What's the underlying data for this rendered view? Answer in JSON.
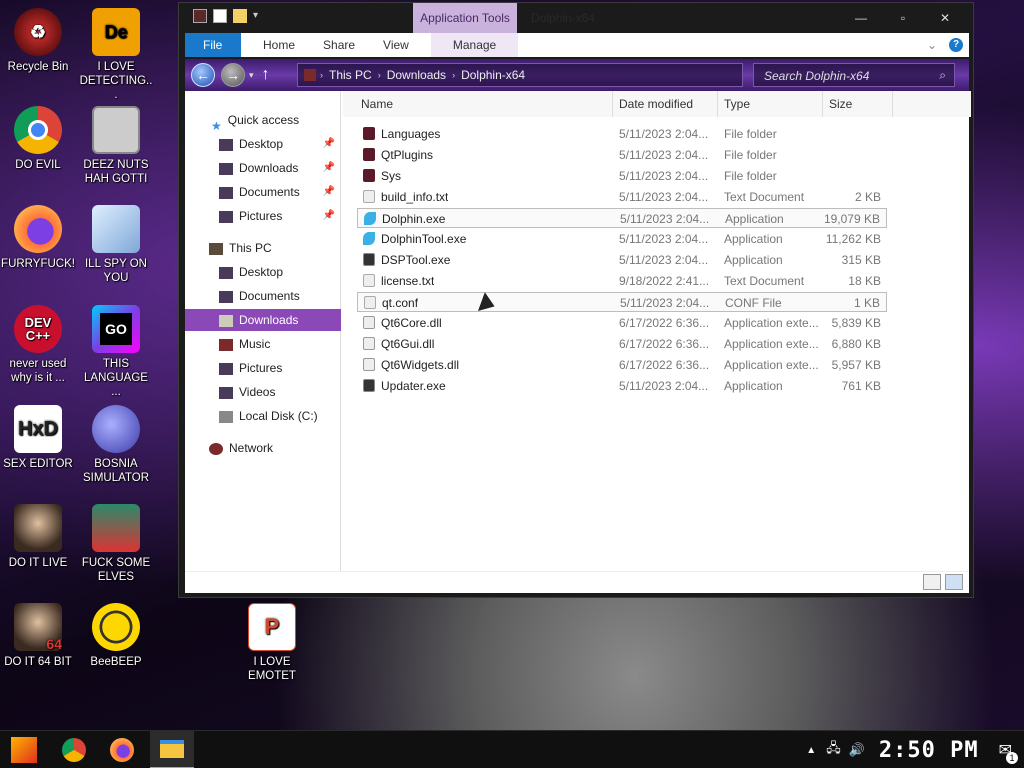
{
  "desktop": {
    "icons": [
      {
        "label": "Recycle Bin"
      },
      {
        "label": "I LOVE DETECTING..."
      },
      {
        "label": "DO EVIL"
      },
      {
        "label": "DEEZ NUTS HAH GOTTI"
      },
      {
        "label": "FURRYFUCK!"
      },
      {
        "label": "ILL SPY ON YOU"
      },
      {
        "label": "never used why is it ..."
      },
      {
        "label": "THIS LANGUAGE ..."
      },
      {
        "label": "SEX EDITOR"
      },
      {
        "label": "BOSNIA SIMULATOR"
      },
      {
        "label": "DO IT LIVE"
      },
      {
        "label": "FUCK SOME ELVES"
      },
      {
        "label": "DO IT 64 BIT"
      },
      {
        "label": "BeeBEEP"
      },
      {
        "label": "I LOVE EMOTET"
      }
    ]
  },
  "window": {
    "contextual_tab": "Application Tools",
    "title": "Dolphin-x64",
    "controls": {
      "minimize": "—",
      "maximize": "▫",
      "close": "✕"
    },
    "ribbon_tabs": [
      "File",
      "Home",
      "Share",
      "View",
      "Manage"
    ],
    "breadcrumb": [
      "This PC",
      "Downloads",
      "Dolphin-x64"
    ],
    "search_placeholder": "Search Dolphin-x64"
  },
  "navpane": {
    "items": [
      {
        "label": "Quick access",
        "icon": "star-icon"
      },
      {
        "label": "Desktop",
        "icon": "desktop-folder-icon",
        "pinned": true
      },
      {
        "label": "Downloads",
        "icon": "downloads-folder-icon",
        "pinned": true
      },
      {
        "label": "Documents",
        "icon": "documents-folder-icon",
        "pinned": true
      },
      {
        "label": "Pictures",
        "icon": "pictures-folder-icon",
        "pinned": true
      },
      {
        "label": "This PC",
        "icon": "computer-icon"
      },
      {
        "label": "Desktop",
        "icon": "desktop-folder-icon"
      },
      {
        "label": "Documents",
        "icon": "documents-folder-icon"
      },
      {
        "label": "Downloads",
        "icon": "downloads-folder-icon",
        "selected": true
      },
      {
        "label": "Music",
        "icon": "music-folder-icon"
      },
      {
        "label": "Pictures",
        "icon": "pictures-folder-icon"
      },
      {
        "label": "Videos",
        "icon": "videos-folder-icon"
      },
      {
        "label": "Local Disk (C:)",
        "icon": "drive-icon"
      },
      {
        "label": "Network",
        "icon": "network-icon"
      }
    ]
  },
  "columns": {
    "name": "Name",
    "date": "Date modified",
    "type": "Type",
    "size": "Size"
  },
  "files": [
    {
      "name": "Languages",
      "date": "5/11/2023 2:04...",
      "type": "File folder",
      "size": "",
      "icon": "folder-icon"
    },
    {
      "name": "QtPlugins",
      "date": "5/11/2023 2:04...",
      "type": "File folder",
      "size": "",
      "icon": "folder-icon"
    },
    {
      "name": "Sys",
      "date": "5/11/2023 2:04...",
      "type": "File folder",
      "size": "",
      "icon": "folder-icon"
    },
    {
      "name": "build_info.txt",
      "date": "5/11/2023 2:04...",
      "type": "Text Document",
      "size": "2 KB",
      "icon": "text-file-icon"
    },
    {
      "name": "Dolphin.exe",
      "date": "5/11/2023 2:04...",
      "type": "Application",
      "size": "19,079 KB",
      "icon": "dolphin-app-icon"
    },
    {
      "name": "DolphinTool.exe",
      "date": "5/11/2023 2:04...",
      "type": "Application",
      "size": "11,262 KB",
      "icon": "dolphin-app-icon"
    },
    {
      "name": "DSPTool.exe",
      "date": "5/11/2023 2:04...",
      "type": "Application",
      "size": "315 KB",
      "icon": "app-icon"
    },
    {
      "name": "license.txt",
      "date": "9/18/2022 2:41...",
      "type": "Text Document",
      "size": "18 KB",
      "icon": "text-file-icon"
    },
    {
      "name": "qt.conf",
      "date": "5/11/2023 2:04...",
      "type": "CONF File",
      "size": "1 KB",
      "icon": "conf-file-icon"
    },
    {
      "name": "Qt6Core.dll",
      "date": "6/17/2022 6:36...",
      "type": "Application exte...",
      "size": "5,839 KB",
      "icon": "dll-file-icon"
    },
    {
      "name": "Qt6Gui.dll",
      "date": "6/17/2022 6:36...",
      "type": "Application exte...",
      "size": "6,880 KB",
      "icon": "dll-file-icon"
    },
    {
      "name": "Qt6Widgets.dll",
      "date": "6/17/2022 6:36...",
      "type": "Application exte...",
      "size": "5,957 KB",
      "icon": "dll-file-icon"
    },
    {
      "name": "Updater.exe",
      "date": "5/11/2023 2:04...",
      "type": "Application",
      "size": "761 KB",
      "icon": "app-icon"
    }
  ],
  "taskbar": {
    "clock": "2:50 PM",
    "notification_count": "1",
    "pinned": [
      "start-button",
      "chrome-icon",
      "firefox-icon",
      "file-explorer-icon"
    ]
  },
  "colors": {
    "accent": "#1979ca",
    "selection": "#8b49b8",
    "context_tab": "#c9b2dc"
  }
}
